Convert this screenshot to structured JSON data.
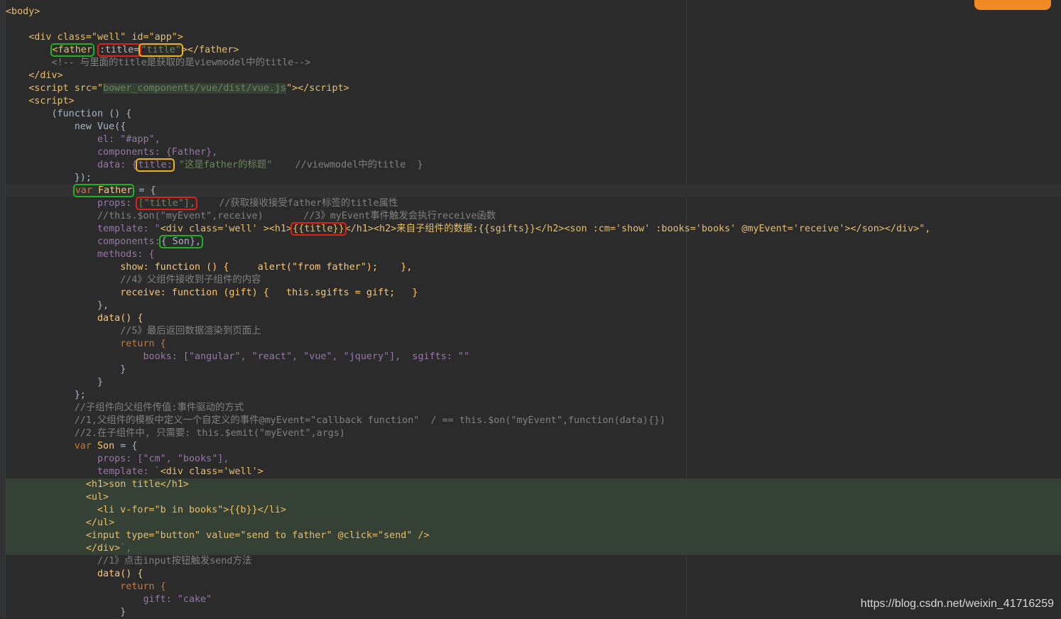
{
  "code": {
    "l1": "<body>",
    "l3a": "<div class=\"well\" id=\"app\">",
    "l4_father": "<father",
    "l4_title_attr": ":title=",
    "l4_title_val": "\"title\"",
    "l4_close": "></father>",
    "l5": "<!-- 与里面的title是获取的是viewmodel中的title-->",
    "l6": "</div>",
    "l7a": "<script src=\"",
    "l7b": "bower_components/vue/dist/vue.js",
    "l7c": "\"></",
    "l7d": "script>",
    "l8": "<script>",
    "l9": "(function () {",
    "l10": "new Vue({",
    "l11": "el: \"#app\",",
    "l12": "components: {Father},",
    "l13a": "data: {",
    "l13b": "title:",
    "l13c": "\"这是father的标题\"",
    "l13d": "//viewmodel中的title  }",
    "l14": "});",
    "l15a": "var",
    "l15b": "Father",
    "l15c": " = {",
    "l16a": "props: ",
    "l16b": "[\"title\"],",
    "l16c": "//获取接收接受father标签的title属性",
    "l17a": "//this.$on(\"myEvent\",receive)",
    "l17b": "//3》myEvent事件触发会执行receive函数",
    "l18a": "template: \"",
    "l18b": "<div class='well' ><h1>",
    "l18c": "{{title}}",
    "l18d": "</h1><h2>来自子组件的数据:{{sgifts}}</h2><son :cm='show' :books='books' @myEvent='receive'></son></div>\",",
    "l19a": "components:",
    "l19b": "{ Son},",
    "l20": "methods: {",
    "l21": "show: function () {     alert(\"from father\");    },",
    "l22": "//4》父组件接收到子组件的内容",
    "l23": "receive: function (gift) {   this.sgifts = gift;   }",
    "l24": "},",
    "l25": "data() {",
    "l26": "//5》最后返回数据渲染到页面上",
    "l27": "return {",
    "l28": "books: [\"angular\", \"react\", \"vue\", \"jquery\"],  sgifts: \"\"",
    "l29": "}",
    "l30": "}",
    "l31": "};",
    "l32": "//子组件向父组件传值:事件驱动的方式",
    "l33": "//1,父组件的模板中定义一个自定义的事件@myEvent=\"callback function\"  / == this.$on(\"myEvent\",function(data){})",
    "l34": "//2.在子组件中, 只需要: this.$emit(\"myEvent\",args)",
    "l35a": "var",
    "l35b": "Son",
    "l35c": " = {",
    "l36": "props: [\"cm\", \"books\"],",
    "l37a": "template: `",
    "l37b": "<div class='well'>",
    "l38": "<h1>son title</h1>",
    "l39": "<ul>",
    "l40": "<li v-for=\"b in books\">{{b}}</li>",
    "l41": "</ul>",
    "l42": "<input type=\"button\" value=\"send to father\" @click=\"send\" />",
    "l43a": "</div>",
    "l43b": "`,",
    "l44": "//1》点击input按钮触发send方法",
    "l45": "data() {",
    "l46": "return {",
    "l47": "gift: \"cake\"",
    "l48": "}"
  },
  "watermark": "https://blog.csdn.net/weixin_41716259",
  "colors": {
    "background": "#2b2b2b",
    "green_box": "#1fb21f",
    "red_box": "#e0201b",
    "yellow_box": "#f0b418"
  }
}
